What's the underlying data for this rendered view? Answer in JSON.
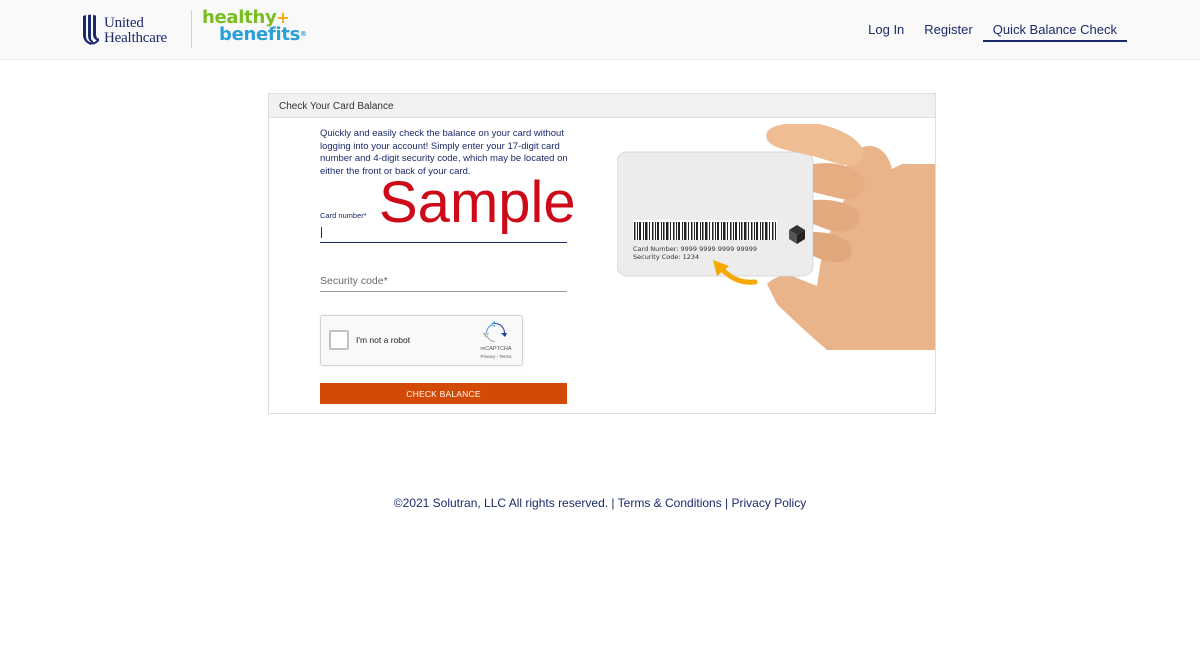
{
  "header": {
    "uhc_logo_line1": "United",
    "uhc_logo_line2": "Healthcare",
    "hb_logo_line1": "healthy",
    "hb_logo_line2": "benefits",
    "nav": {
      "login": "Log In",
      "register": "Register",
      "quick_balance": "Quick Balance Check"
    }
  },
  "panel": {
    "title": "Check Your Card Balance",
    "intro": "Quickly and easily check the balance on your card without logging into your account! Simply enter your 17-digit card number and 4-digit security code, which may be located on either the front or back of your card.",
    "card_number_label": "Card number*",
    "card_number_value": "",
    "security_code_placeholder": "Security code*",
    "security_code_value": "",
    "captcha": {
      "label": "I'm not a robot",
      "brand": "reCAPTCHA",
      "links": "Privacy - Terms"
    },
    "button_label": "CHECK BALANCE",
    "card_image": {
      "card_number_text": "Card Number:  9999 9999 9999 99999",
      "security_code_text": "Security Code: 1234",
      "watermark": "Sample"
    }
  },
  "footer": {
    "copyright": "©2021 Solutran, LLC All rights reserved.",
    "sep1": " | ",
    "terms": "Terms & Conditions",
    "sep2": " | ",
    "privacy": "Privacy Policy"
  },
  "colors": {
    "brand_navy": "#1c2a6b",
    "button_orange": "#d34a06",
    "hb_green": "#78be20",
    "hb_blue": "#2a9fd8",
    "arrow_orange": "#f5a800",
    "watermark_red": "#cc0a18"
  }
}
